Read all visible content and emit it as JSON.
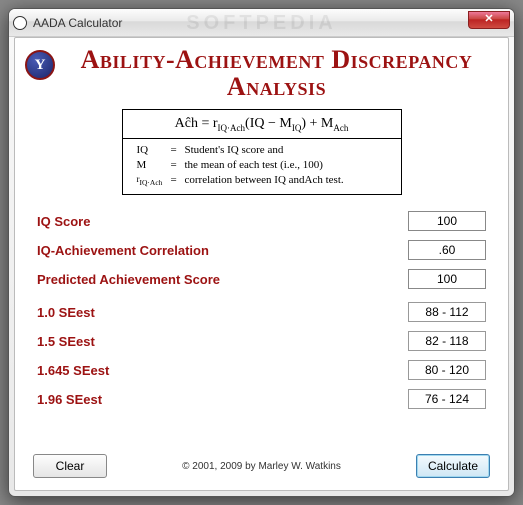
{
  "window": {
    "title": "AADA Calculator",
    "watermark": "SOFTPEDIA",
    "close_glyph": "✕"
  },
  "header": {
    "title_html": "Ability-Achievement Discrepancy Analysis"
  },
  "formula": {
    "equation": "Aĉh = r_IQ·Ach(IQ − M_IQ) + M_Ach",
    "iq_key": "IQ",
    "iq_desc": "Student's IQ score and",
    "m_key": "M",
    "m_desc": "the mean of each test (i.e., 100)",
    "r_key": "r_IQ·Ach",
    "r_desc": "correlation between IQ andAch test."
  },
  "fields": {
    "iq_label": "IQ Score",
    "iq_value": "100",
    "corr_label": "IQ-Achievement Correlation",
    "corr_value": ".60",
    "pred_label": "Predicted Achievement Score",
    "pred_value": "100"
  },
  "seest": [
    {
      "label": "1.0 SEest",
      "range": "88 - 112"
    },
    {
      "label": "1.5 SEest",
      "range": "82 - 118"
    },
    {
      "label": "1.645 SEest",
      "range": "80 - 120"
    },
    {
      "label": "1.96 SEest",
      "range": "76 - 124"
    }
  ],
  "footer": {
    "clear_label": "Clear",
    "calc_label": "Calculate",
    "copyright": "© 2001, 2009 by Marley W. Watkins"
  }
}
